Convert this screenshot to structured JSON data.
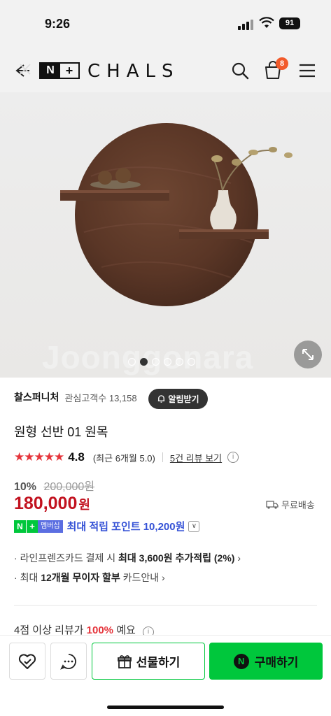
{
  "status_bar": {
    "time": "9:26",
    "battery": "91"
  },
  "header": {
    "logo_n": "N",
    "logo_plus": "+",
    "brand": "CHALS",
    "cart_count": "8"
  },
  "hero": {
    "watermark": "Joonggonara",
    "dots_count": 6,
    "active_dot": 1
  },
  "store": {
    "name": "찰스퍼니처",
    "follow_label": "관심고객수",
    "follow_count": "13,158",
    "follow_button": "알림받기"
  },
  "product": {
    "title": "원형 선반 01 원목",
    "stars": "★★★★★",
    "rating": "4.8",
    "recent_rating": "(최근 6개월 5.0)",
    "review_link": "5건 리뷰 보기",
    "discount": "10%",
    "original_price": "200,000원",
    "price": "180,000",
    "currency": "원",
    "shipping": "무료배송"
  },
  "points": {
    "badge_n": "N",
    "badge_plus": "+",
    "badge_member": "멤버십",
    "text": "최대 적립 포인트 10,200원"
  },
  "benefits": {
    "b1_pre": "라인프렌즈카드 결제 시 ",
    "b1_bold": "최대 3,600원 추가적립 (2%)",
    "b2_pre": "최대 ",
    "b2_bold": "12개월 무이자 할부",
    "b2_post": " 카드안내"
  },
  "review_hint": {
    "pre": "4점 이상 리뷰가 ",
    "pct": "100%",
    "post": " 예요"
  },
  "bottom_bar": {
    "gift_label": "선물하기",
    "buy_label": "구매하기",
    "n_logo": "N"
  },
  "colors": {
    "accent_green": "#00c73c",
    "price_red": "#c2121f",
    "points_blue": "#3552d6",
    "star_red": "#e5343b"
  },
  "icons": [
    "back-icon",
    "close-icon",
    "search-icon",
    "shopping-bag-icon",
    "menu-icon",
    "expand-icon",
    "bell-icon",
    "info-icon",
    "truck-icon",
    "heart-check-icon",
    "chat-icon",
    "gift-icon"
  ]
}
